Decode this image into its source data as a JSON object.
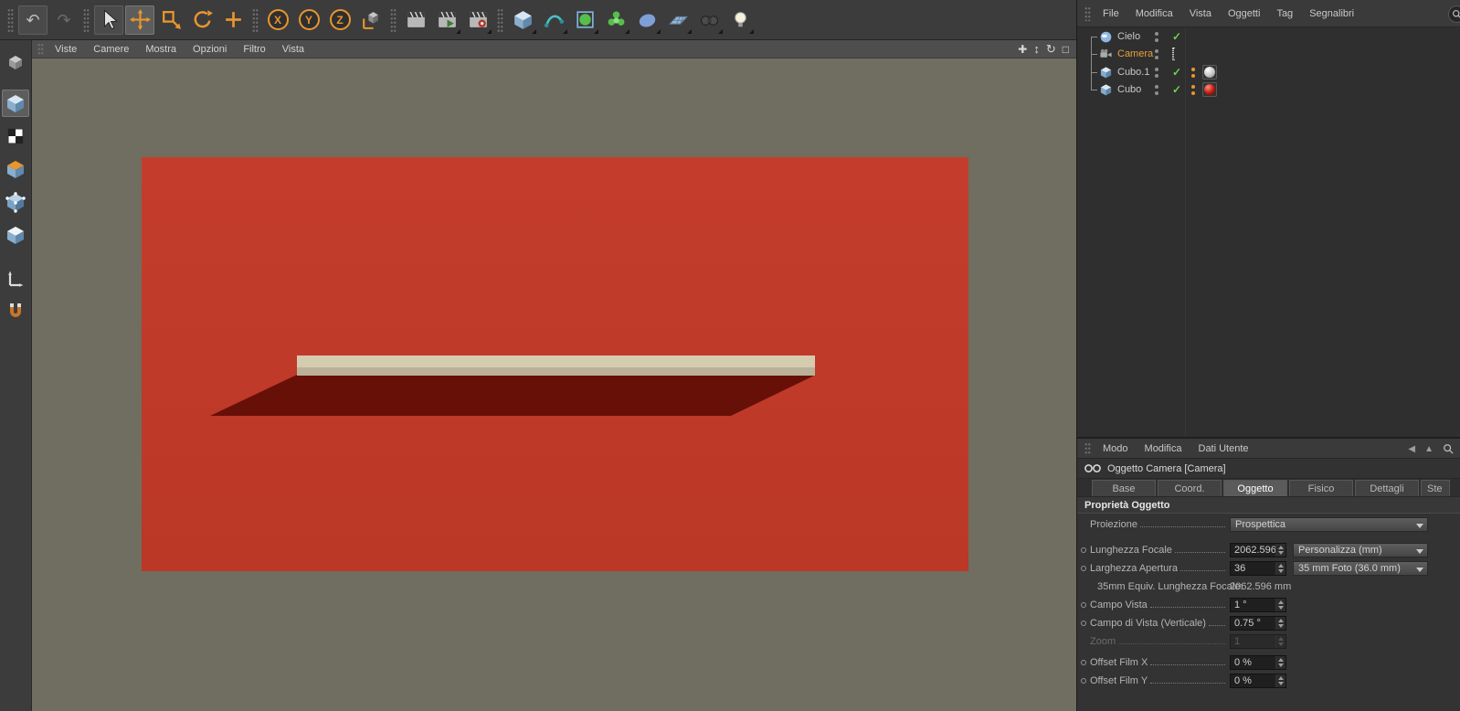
{
  "icons": {
    "axis_x": "X",
    "axis_y": "Y",
    "axis_z": "Z"
  },
  "viewport": {
    "menu": [
      "Viste",
      "Camere",
      "Mostra",
      "Opzioni",
      "Filtro",
      "Vista"
    ]
  },
  "object_manager": {
    "menu": [
      "File",
      "Modifica",
      "Vista",
      "Oggetti",
      "Tag",
      "Segnalibri"
    ],
    "objects": [
      {
        "name": "Cielo"
      },
      {
        "name": "Camera"
      },
      {
        "name": "Cubo.1"
      },
      {
        "name": "Cubo"
      }
    ]
  },
  "attribute_manager": {
    "menu": [
      "Modo",
      "Modifica",
      "Dati Utente"
    ],
    "title": "Oggetto Camera [Camera]",
    "tabs": [
      "Base",
      "Coord.",
      "Oggetto",
      "Fisico",
      "Dettagli",
      "Ste"
    ],
    "section": "Proprietà Oggetto",
    "rows": [
      {
        "label": "Proiezione",
        "dropdown": "Prospettica"
      },
      {
        "label": "Lunghezza Focale",
        "value": "2062.596",
        "dropdown": "Personalizza (mm)"
      },
      {
        "label": "Larghezza Apertura",
        "value": "36",
        "dropdown": "35 mm Foto (36.0 mm)"
      },
      {
        "label": "35mm Equiv. Lunghezza Focale:",
        "value": "2062.596 mm"
      },
      {
        "label": "Campo Vista",
        "value": "1 °"
      },
      {
        "label": "Campo di Vista (Verticale)",
        "value": "0.75 °"
      },
      {
        "label": "Zoom",
        "value": "1"
      },
      {
        "label": "Offset Film X",
        "value": "0 %"
      },
      {
        "label": "Offset Film Y",
        "value": "0 %"
      }
    ]
  }
}
